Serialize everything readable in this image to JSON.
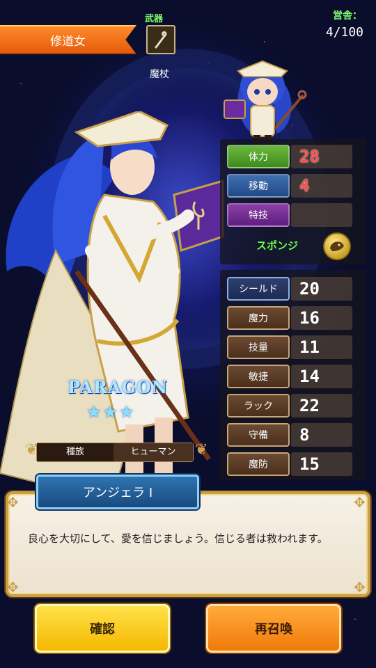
{
  "unit": {
    "class_name": "修道女",
    "name": "アンジェラ Ⅰ",
    "rarity_label": "PARAGON",
    "rarity_stars": 3,
    "race_label": "種族",
    "race_value": "ヒューマン"
  },
  "weapon": {
    "label": "武器",
    "name": "魔杖",
    "icon": "staff-icon"
  },
  "barracks": {
    "label": "営舎：",
    "count": "4/100"
  },
  "primary_stats": [
    {
      "label": "体力",
      "value": "28",
      "color": "#6bb83c"
    },
    {
      "label": "移動",
      "value": "4",
      "color": "#3f6fb0"
    }
  ],
  "skill": {
    "label": "特技",
    "name": "スポンジ",
    "icon": "sponge-skill-icon",
    "color": "#8a3fa8"
  },
  "secondary_stats": [
    {
      "label": "シールド",
      "value": "20"
    },
    {
      "label": "魔力",
      "value": "16"
    },
    {
      "label": "技量",
      "value": "11"
    },
    {
      "label": "敏捷",
      "value": "14"
    },
    {
      "label": "ラック",
      "value": "22"
    },
    {
      "label": "守備",
      "value": "8"
    },
    {
      "label": "魔防",
      "value": "15"
    }
  ],
  "dialogue": {
    "text": "良心を大切にして、愛を信じましょう。信じる者は救われます。"
  },
  "buttons": {
    "confirm": "確認",
    "resummon": "再召喚"
  }
}
